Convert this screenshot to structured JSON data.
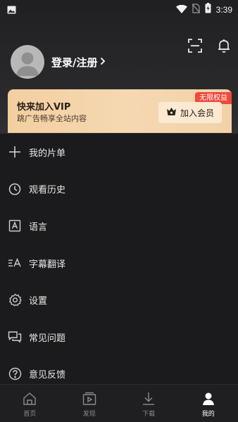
{
  "status_bar": {
    "time": "3:39",
    "icons": [
      "image-icon",
      "wifi-icon",
      "no-sim-icon",
      "battery-icon"
    ]
  },
  "header": {
    "actions": [
      "scan-icon",
      "bell-icon"
    ]
  },
  "profile": {
    "login_label": "登录/注册"
  },
  "vip": {
    "title": "快来加入VIP",
    "subtitle": "跳广告畅享全站内容",
    "badge": "无限权益",
    "button_label": "加入会员",
    "button_icon": "crown-basket-icon"
  },
  "menu": {
    "items": [
      {
        "label": "我的片单",
        "icon": "plus-icon"
      },
      {
        "label": "观看历史",
        "icon": "clock-icon"
      },
      {
        "label": "语言",
        "icon": "language-icon"
      },
      {
        "label": "字幕翻译",
        "icon": "subtitle-translate-icon"
      },
      {
        "label": "设置",
        "icon": "gear-icon"
      },
      {
        "label": "常见问题",
        "icon": "chat-icon"
      },
      {
        "label": "意见反馈",
        "icon": "question-icon"
      }
    ]
  },
  "bottom_nav": {
    "items": [
      {
        "label": "首页",
        "icon": "home-icon",
        "active": false
      },
      {
        "label": "发现",
        "icon": "discover-icon",
        "active": false
      },
      {
        "label": "下载",
        "icon": "download-icon",
        "active": false
      },
      {
        "label": "我的",
        "icon": "user-icon",
        "active": true
      }
    ]
  },
  "colors": {
    "background": "#1b1b1d",
    "vip_gold": "#f3cfa0",
    "badge_red": "#f0483b",
    "nav_active": "#ffffff",
    "nav_inactive": "#8c8c8c"
  }
}
